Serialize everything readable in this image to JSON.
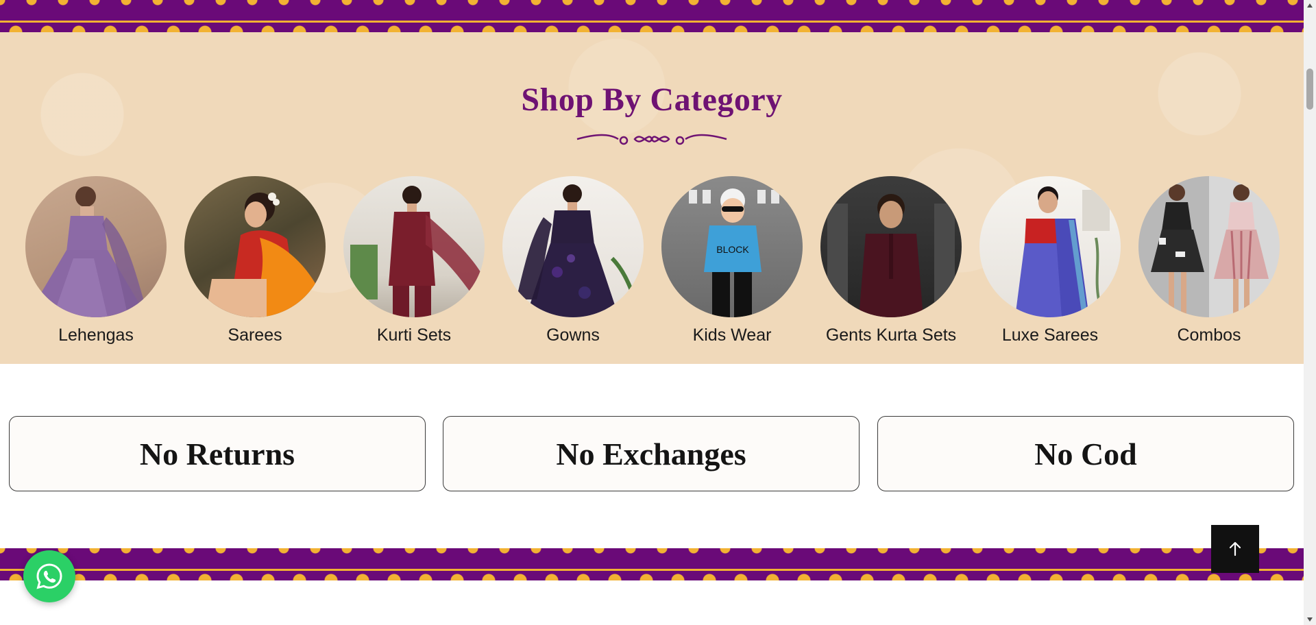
{
  "section": {
    "title": "Shop By Category"
  },
  "categories": [
    {
      "label": "Lehengas",
      "icon": "lehenga-photo"
    },
    {
      "label": "Sarees",
      "icon": "saree-photo"
    },
    {
      "label": "Kurti Sets",
      "icon": "kurti-set-photo"
    },
    {
      "label": "Gowns",
      "icon": "gown-photo"
    },
    {
      "label": "Kids Wear",
      "icon": "kids-wear-photo"
    },
    {
      "label": "Gents Kurta Sets",
      "icon": "gents-kurta-photo"
    },
    {
      "label": "Luxe Sarees",
      "icon": "luxe-saree-photo"
    },
    {
      "label": "Combos",
      "icon": "combos-photo"
    }
  ],
  "policies": [
    {
      "label": "No Returns"
    },
    {
      "label": "No Exchanges"
    },
    {
      "label": "No Cod"
    }
  ],
  "colors": {
    "brand_purple": "#6e1273",
    "band_purple": "#6a0a78",
    "band_gold": "#f2b233",
    "section_bg": "#f0d9ba",
    "whatsapp_green": "#2bd066"
  },
  "icons": {
    "scroll_top": "arrow-up-icon",
    "whatsapp": "whatsapp-icon"
  }
}
